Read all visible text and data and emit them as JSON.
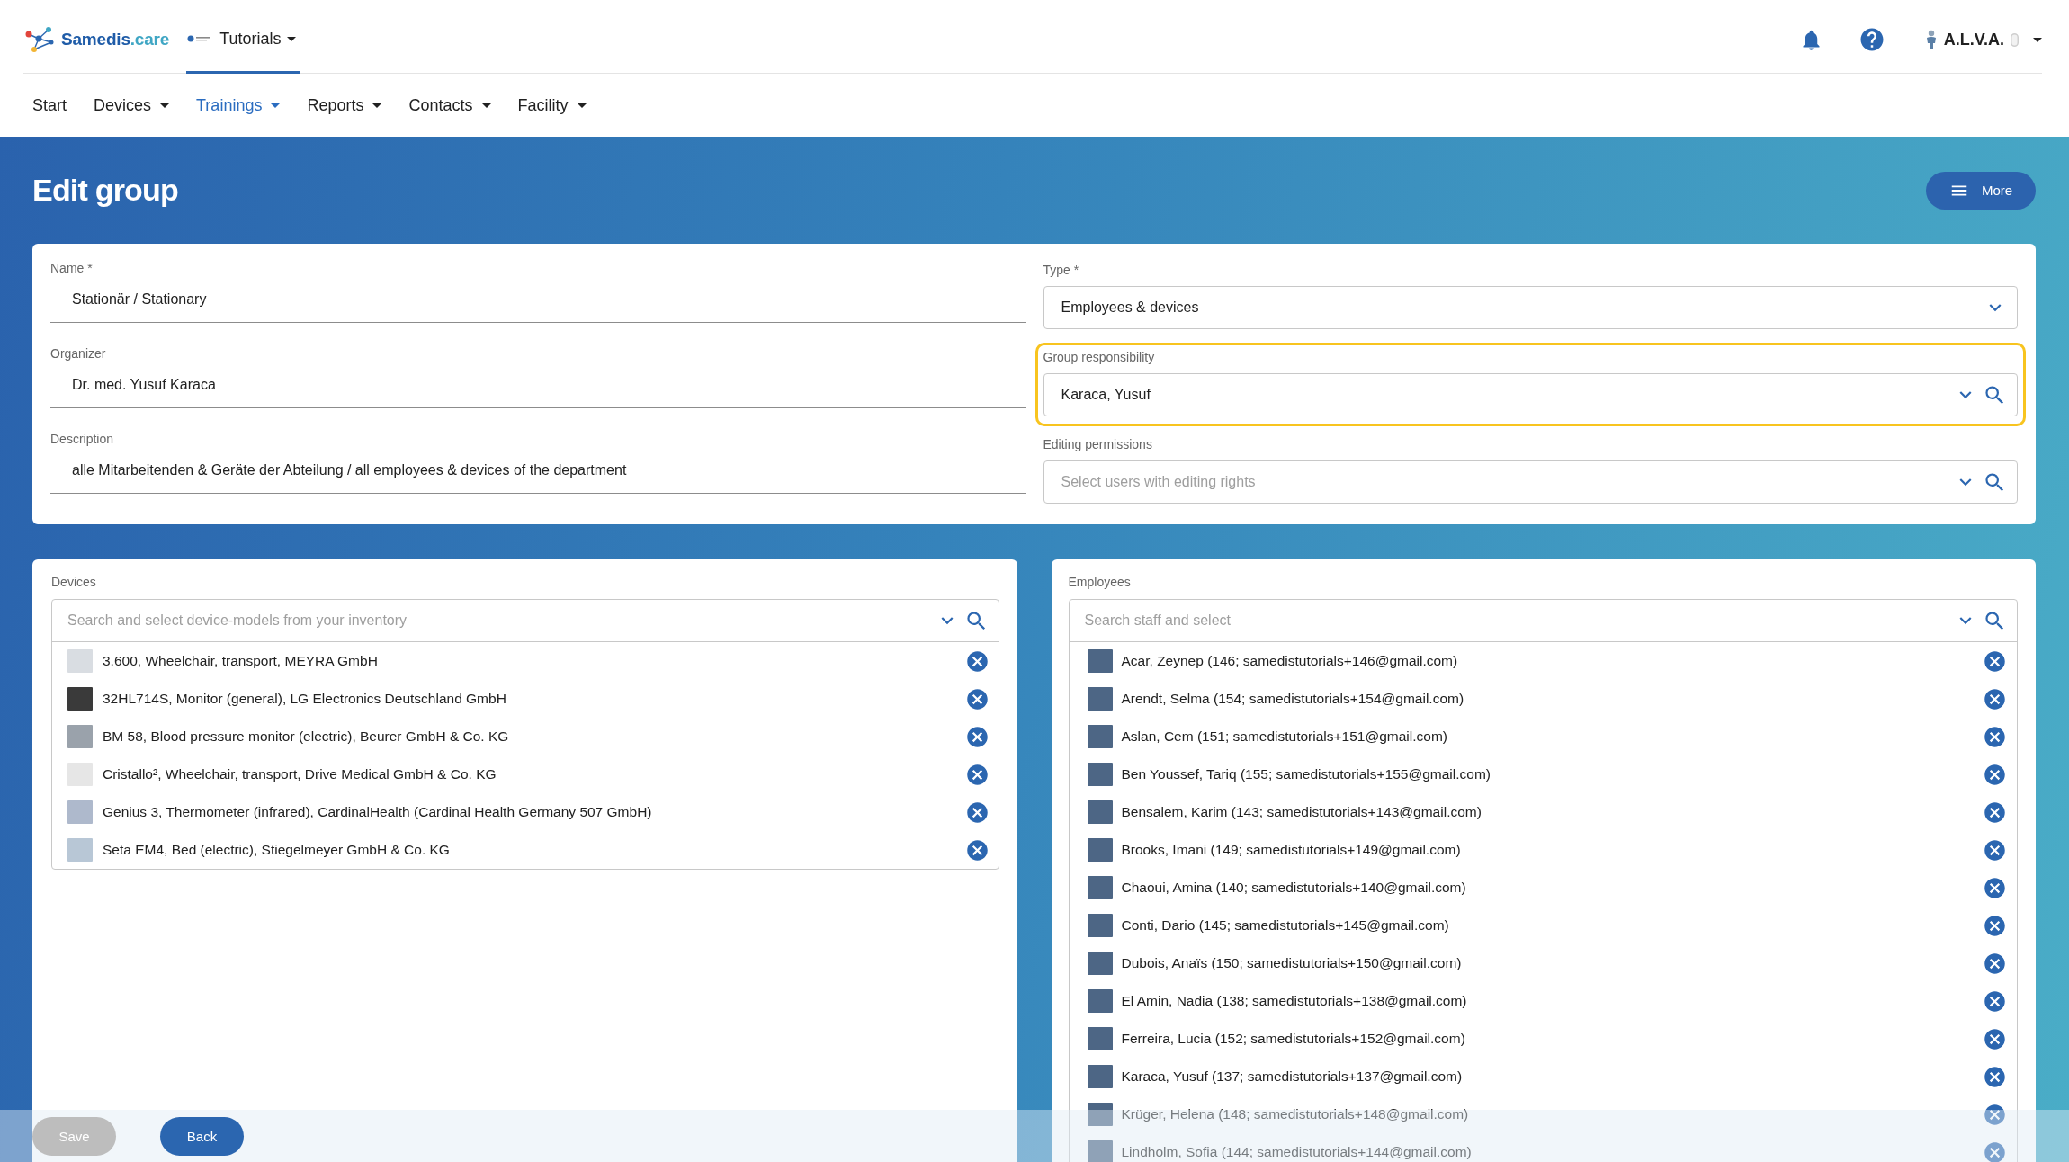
{
  "header": {
    "logo": {
      "name": "Samedis",
      "suffix": ".care"
    },
    "tenant": {
      "label": "Tutorials",
      "selected": true
    },
    "user": {
      "name": "A.L.V.A."
    }
  },
  "nav": [
    {
      "label": "Start",
      "selected": false,
      "has_menu": false
    },
    {
      "label": "Devices",
      "selected": false,
      "has_menu": true
    },
    {
      "label": "Trainings",
      "selected": true,
      "has_menu": true
    },
    {
      "label": "Reports",
      "selected": false,
      "has_menu": true
    },
    {
      "label": "Contacts",
      "selected": false,
      "has_menu": true
    },
    {
      "label": "Facility",
      "selected": false,
      "has_menu": true
    }
  ],
  "page": {
    "title": "Edit group",
    "more_button": "More"
  },
  "form": {
    "left_fields": [
      {
        "label": "Name *",
        "value": "Stationär / Stationary"
      },
      {
        "label": "Organizer",
        "value": "Dr. med. Yusuf Karaca"
      },
      {
        "label": "Description",
        "value": "alle Mitarbeitenden & Geräte der Abteilung / all employees & devices of the department"
      }
    ],
    "right_fields": [
      {
        "label": "Type *",
        "kind": "select",
        "value": "Employees & devices",
        "highlighted": false
      },
      {
        "label": "Group responsibility",
        "kind": "search_select",
        "value": "Karaca, Yusuf",
        "highlighted": true
      },
      {
        "label": "Editing permissions",
        "kind": "search_select",
        "placeholder": "Select users with editing rights",
        "highlighted": false
      }
    ]
  },
  "devices": {
    "label": "Devices",
    "placeholder": "Search and select device-models from your inventory",
    "items": [
      {
        "label": "3.600, Wheelchair, transport, MEYRA GmbH"
      },
      {
        "label": "32HL714S, Monitor (general), LG Electronics Deutschland GmbH"
      },
      {
        "label": "BM 58, Blood pressure monitor (electric), Beurer GmbH & Co. KG"
      },
      {
        "label": "Cristallo², Wheelchair, transport, Drive Medical GmbH & Co. KG"
      },
      {
        "label": "Genius 3, Thermometer (infrared), CardinalHealth (Cardinal Health Germany 507 GmbH)"
      },
      {
        "label": "Seta EM4, Bed (electric), Stiegelmeyer GmbH & Co. KG"
      }
    ]
  },
  "employees": {
    "label": "Employees",
    "placeholder": "Search staff and select",
    "items": [
      {
        "label": "Acar, Zeynep (146; samedistutorials+146@gmail.com)"
      },
      {
        "label": "Arendt, Selma (154; samedistutorials+154@gmail.com)"
      },
      {
        "label": "Aslan, Cem (151; samedistutorials+151@gmail.com)"
      },
      {
        "label": "Ben Youssef, Tariq (155; samedistutorials+155@gmail.com)"
      },
      {
        "label": "Bensalem, Karim (143; samedistutorials+143@gmail.com)"
      },
      {
        "label": "Brooks, Imani (149; samedistutorials+149@gmail.com)"
      },
      {
        "label": "Chaoui, Amina (140; samedistutorials+140@gmail.com)"
      },
      {
        "label": "Conti, Dario (145; samedistutorials+145@gmail.com)"
      },
      {
        "label": "Dubois, Anaïs (150; samedistutorials+150@gmail.com)"
      },
      {
        "label": "El Amin, Nadia (138; samedistutorials+138@gmail.com)"
      },
      {
        "label": "Ferreira, Lucia (152; samedistutorials+152@gmail.com)"
      },
      {
        "label": "Karaca, Yusuf (137; samedistutorials+137@gmail.com)"
      },
      {
        "label": "Krüger, Helena (148; samedistutorials+148@gmail.com)"
      },
      {
        "label": "Lindholm, Sofia (144; samedistutorials+144@gmail.com)"
      }
    ]
  },
  "footer": {
    "buttons": [
      {
        "label": "Save",
        "disabled": true
      },
      {
        "label": "Back",
        "disabled": false
      }
    ]
  }
}
